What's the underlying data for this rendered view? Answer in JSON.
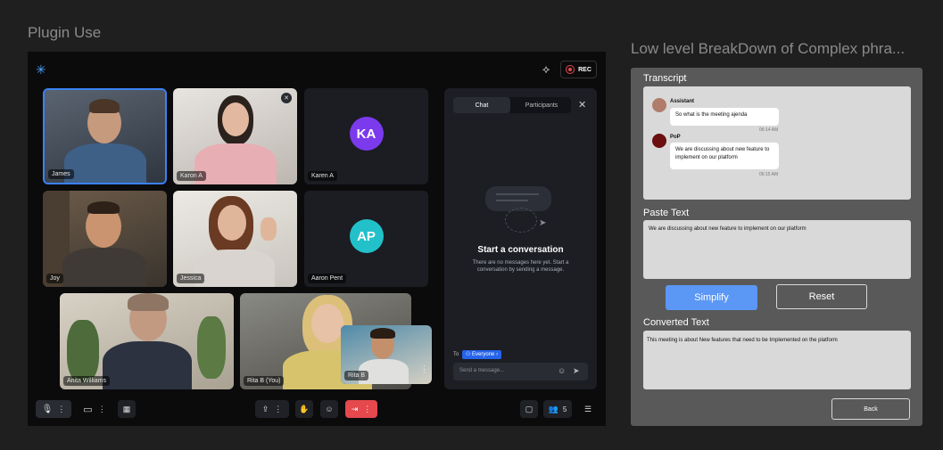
{
  "left_title": "Plugin Use",
  "right_title": "Low level BreakDown of Complex phra...",
  "meeting": {
    "rec_label": "REC",
    "participants": [
      {
        "name": "James"
      },
      {
        "name": "Karon A"
      },
      {
        "name": "Karen A",
        "initials": "KA"
      },
      {
        "name": "Joy"
      },
      {
        "name": "Jessica"
      },
      {
        "name": "Aaron Pent",
        "initials": "AP"
      },
      {
        "name": "Anita Williams"
      },
      {
        "name": "Rita B (You)"
      },
      {
        "name": "Rita B"
      }
    ],
    "participant_count": "5",
    "colors": {
      "accent_blue": "#3b82f6",
      "ka": "#7c3aed",
      "ap": "#22c1c9",
      "rec_red": "#e5484d"
    }
  },
  "chat": {
    "tab_chat": "Chat",
    "tab_participants": "Participants",
    "empty_title": "Start a conversation",
    "empty_desc": "There are no messages here yet. Start a conversation by sending a message.",
    "to_label": "To",
    "recipient": "Everyone",
    "input_placeholder": "Send a message..."
  },
  "transcript": {
    "label": "Transcript",
    "messages": [
      {
        "sender": "Assistant",
        "text": "So what is the meeting ajenda",
        "time": "06:14 AM"
      },
      {
        "sender": "PoP",
        "text": "We are discussing about new feature to implement on our platform",
        "time": "06:15 AM"
      }
    ]
  },
  "paste": {
    "label": "Paste Text",
    "value": "We are discussing about new feature to implement on our platform"
  },
  "buttons": {
    "simplify": "Simplify",
    "reset": "Reset",
    "back": "Back"
  },
  "converted": {
    "label": "Converted Text",
    "value": "This meeting is about New features that need to be Implemented on the platform"
  }
}
